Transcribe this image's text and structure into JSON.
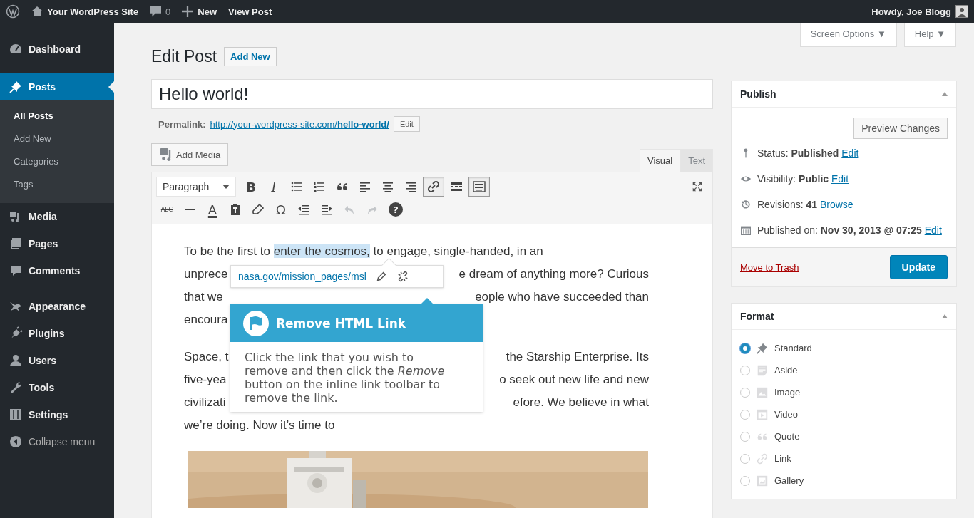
{
  "admin_bar": {
    "site_name": "Your WordPress Site",
    "comments_count": "0",
    "new_label": "New",
    "view_label": "View Post",
    "greeting": "Howdy, Joe Blogg"
  },
  "sidebar": {
    "items": [
      {
        "label": "Dashboard",
        "selected": false
      },
      {
        "label": "Posts",
        "selected": true,
        "children": [
          {
            "label": "All Posts",
            "selected": true
          },
          {
            "label": "Add New",
            "selected": false
          },
          {
            "label": "Categories",
            "selected": false
          },
          {
            "label": "Tags",
            "selected": false
          }
        ]
      },
      {
        "label": "Media",
        "selected": false
      },
      {
        "label": "Pages",
        "selected": false
      },
      {
        "label": "Comments",
        "selected": false
      },
      {
        "label": "Appearance",
        "selected": false
      },
      {
        "label": "Plugins",
        "selected": false
      },
      {
        "label": "Users",
        "selected": false
      },
      {
        "label": "Tools",
        "selected": false
      },
      {
        "label": "Settings",
        "selected": false
      },
      {
        "label": "Collapse menu",
        "selected": false
      }
    ]
  },
  "screen_tabs": [
    "Screen Options ▼",
    "Help ▼"
  ],
  "heading": "Edit Post",
  "add_new": "Add New",
  "post_title": "Hello world!",
  "permalink": {
    "label": "Permalink:",
    "url": "http://your-wordpress-site.com/**hello-world/**",
    "edit": "Edit"
  },
  "add_media": "Add Media",
  "editor_tabs": [
    {
      "label": "Visual",
      "selected": true
    },
    {
      "label": "Text",
      "selected": false
    }
  ],
  "format_select": "Paragraph",
  "toolbar_rows": [
    [
      {
        "kind": "glyph",
        "label": "B",
        "pressed": false,
        "disabled": false
      },
      {
        "kind": "glyph",
        "label": "I",
        "pressed": false,
        "disabled": false
      },
      {
        "kind": "icon",
        "pressed": false,
        "disabled": false
      },
      {
        "kind": "icon",
        "pressed": false,
        "disabled": false
      },
      {
        "kind": "icon",
        "pressed": false,
        "disabled": false
      },
      {
        "kind": "icon",
        "pressed": false,
        "disabled": false
      },
      {
        "kind": "icon",
        "pressed": false,
        "disabled": false
      },
      {
        "kind": "icon",
        "pressed": false,
        "disabled": false
      },
      {
        "kind": "icon",
        "pressed": true,
        "disabled": false
      },
      {
        "kind": "icon",
        "pressed": false,
        "disabled": false
      },
      {
        "kind": "icon",
        "pressed": true,
        "disabled": false
      }
    ],
    [
      {
        "kind": "glyph",
        "label": "ABC",
        "pressed": false,
        "disabled": false
      },
      {
        "kind": "icon",
        "pressed": false,
        "disabled": false
      },
      {
        "kind": "glyph",
        "label": "A",
        "pressed": false,
        "disabled": false
      },
      {
        "kind": "icon",
        "pressed": false,
        "disabled": false
      },
      {
        "kind": "icon",
        "pressed": false,
        "disabled": false
      },
      {
        "kind": "glyph",
        "label": "Ω",
        "pressed": false,
        "disabled": false
      },
      {
        "kind": "icon",
        "pressed": false,
        "disabled": false
      },
      {
        "kind": "icon",
        "pressed": false,
        "disabled": false
      },
      {
        "kind": "icon",
        "pressed": false,
        "disabled": true
      },
      {
        "kind": "icon",
        "pressed": false,
        "disabled": true
      },
      {
        "kind": "glyph",
        "label": "?",
        "pressed": false,
        "disabled": false
      }
    ]
  ],
  "paragraphs": [
    {
      "lines": [
        {
          "parts": [
            [
              {
                "text": "To be the first to ",
                "selected": false
              },
              {
                "text": "enter the cosmos,",
                "selected": true
              },
              {
                "text": " to engage, single-handed, in an",
                "selected": false
              }
            ]
          ]
        },
        {
          "parts": [
            [
              {
                "text": "unprece",
                "selected": false
              }
            ],
            [
              {
                "text": "e dream of anything more? Curious",
                "selected": false
              }
            ]
          ]
        },
        {
          "parts": [
            [
              {
                "text": "that we",
                "selected": false
              }
            ],
            [
              {
                "text": "eople who have succeeded than",
                "selected": false
              }
            ]
          ]
        },
        {
          "parts": [
            [
              {
                "text": "encoura",
                "selected": false
              }
            ]
          ]
        }
      ]
    },
    {
      "lines": [
        {
          "parts": [
            [
              {
                "text": "Space, t",
                "selected": false
              }
            ],
            [
              {
                "text": "the Starship Enterprise. Its",
                "selected": false
              }
            ]
          ]
        },
        {
          "parts": [
            [
              {
                "text": "five-yea",
                "selected": false
              }
            ],
            [
              {
                "text": "o seek out new life and new",
                "selected": false
              }
            ]
          ]
        },
        {
          "parts": [
            [
              {
                "text": "civilizati",
                "selected": false
              }
            ],
            [
              {
                "text": "efore. We believe in what",
                "selected": false
              }
            ]
          ]
        },
        {
          "parts": [
            [
              {
                "text": "we’re doing. Now it’s time to",
                "selected": false
              }
            ]
          ]
        }
      ]
    }
  ],
  "link_toolbar": {
    "url": "nasa.gov/mission_pages/msl"
  },
  "help_popover": {
    "title": "Remove HTML Link",
    "body": "Click the link that you wish to remove and then click the *Remove* button on the  inline link toolbar to remove the link."
  },
  "publish": {
    "title": "Publish",
    "preview": "Preview Changes",
    "rows": [
      {
        "label": "Status:",
        "value": "Published",
        "link": "Edit"
      },
      {
        "label": "Visibility:",
        "value": "Public",
        "link": "Edit"
      },
      {
        "label": "Revisions:",
        "value": "41",
        "link": "Browse"
      },
      {
        "label": "Published on:",
        "value": "Nov 30, 2013 @ 07:25",
        "link": "Edit"
      }
    ],
    "trash": "Move to Trash",
    "update": "Update"
  },
  "format": {
    "title": "Format",
    "options": [
      {
        "label": "Standard",
        "selected": true
      },
      {
        "label": "Aside",
        "selected": false
      },
      {
        "label": "Image",
        "selected": false
      },
      {
        "label": "Video",
        "selected": false
      },
      {
        "label": "Quote",
        "selected": false
      },
      {
        "label": "Link",
        "selected": false
      },
      {
        "label": "Gallery",
        "selected": false
      }
    ]
  }
}
